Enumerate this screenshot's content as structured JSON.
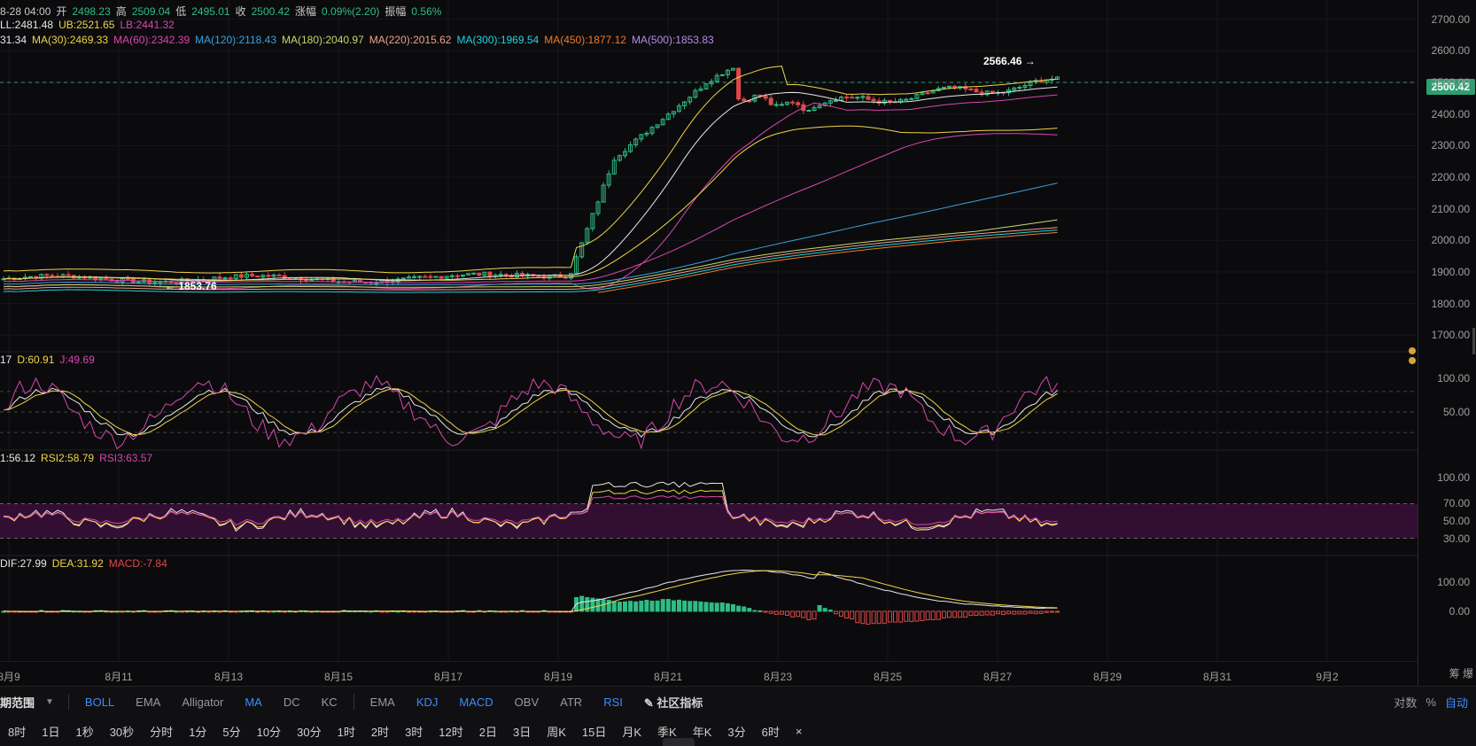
{
  "header": {
    "ohlc": [
      {
        "label": "8-28 04:00",
        "color": "#c8c8c8"
      },
      {
        "label": "开",
        "color": "#c8c8c8"
      },
      {
        "label": "2498.23",
        "color": "#2ebd85"
      },
      {
        "label": "高",
        "color": "#c8c8c8"
      },
      {
        "label": "2509.04",
        "color": "#2ebd85"
      },
      {
        "label": "低",
        "color": "#c8c8c8"
      },
      {
        "label": "2495.01",
        "color": "#2ebd85"
      },
      {
        "label": "收",
        "color": "#c8c8c8"
      },
      {
        "label": "2500.42",
        "color": "#2ebd85"
      },
      {
        "label": "涨幅",
        "color": "#c8c8c8"
      },
      {
        "label": "0.09%(2.20)",
        "color": "#2ebd85"
      },
      {
        "label": "振幅",
        "color": "#c8c8c8"
      },
      {
        "label": "0.56%",
        "color": "#2ebd85"
      }
    ],
    "boll": [
      {
        "label": "LL:2481.48",
        "color": "#e8e8e8"
      },
      {
        "label": "UB:2521.65",
        "color": "#f0d44a"
      },
      {
        "label": "LB:2441.32",
        "color": "#d946b0"
      }
    ],
    "ma": [
      {
        "label": "31.34",
        "color": "#e8e8e8"
      },
      {
        "label": "MA(30):2469.33",
        "color": "#f0d44a"
      },
      {
        "label": "MA(60):2342.39",
        "color": "#d946b0"
      },
      {
        "label": "MA(120):2118.43",
        "color": "#3aa0e0"
      },
      {
        "label": "MA(180):2040.97",
        "color": "#c7d86a"
      },
      {
        "label": "MA(220):2015.62",
        "color": "#f0a08a"
      },
      {
        "label": "MA(300):1969.54",
        "color": "#22d3e0"
      },
      {
        "label": "MA(450):1877.12",
        "color": "#f07a2a"
      },
      {
        "label": "MA(500):1853.83",
        "color": "#b48cf0"
      }
    ]
  },
  "kdj_legend": [
    {
      "label": "17",
      "color": "#e8e8e8"
    },
    {
      "label": "D:60.91",
      "color": "#f0d44a"
    },
    {
      "label": "J:49.69",
      "color": "#d946b0"
    }
  ],
  "rsi_legend": [
    {
      "label": "1:56.12",
      "color": "#e8e8e8"
    },
    {
      "label": "RSI2:58.79",
      "color": "#f0d44a"
    },
    {
      "label": "RSI3:63.57",
      "color": "#d946b0"
    }
  ],
  "macd_legend": [
    {
      "label": "DIF:27.99",
      "color": "#e8e8e8"
    },
    {
      "label": "DEA:31.92",
      "color": "#f0d44a"
    },
    {
      "label": "MACD:-7.84",
      "color": "#e04848"
    }
  ],
  "price_axis": [
    "2700.00",
    "2600.00",
    "2500.00",
    "2400.00",
    "2300.00",
    "2200.00",
    "2100.00",
    "2000.00",
    "1900.00",
    "1800.00",
    "1700.00"
  ],
  "current_price": "2500.42",
  "kdj_axis": [
    "100.00",
    "50.00"
  ],
  "rsi_axis": [
    "100.00",
    "70.00",
    "50.00",
    "30.00"
  ],
  "macd_axis": [
    "100.00",
    "0.00"
  ],
  "max_label": "2566.46 →",
  "min_label": "← 1853.76",
  "dates": [
    "8月9",
    "8月11",
    "8月13",
    "8月15",
    "8月17",
    "8月19",
    "8月21",
    "8月23",
    "8月25",
    "8月27",
    "8月29",
    "8月31",
    "9月2"
  ],
  "axis_corner": "筹 爆",
  "toolbar": {
    "title": "期范围",
    "main_indicators": [
      {
        "label": "BOLL",
        "active": true
      },
      {
        "label": "EMA",
        "active": false
      },
      {
        "label": "Alligator",
        "active": false
      },
      {
        "label": "MA",
        "active": true
      },
      {
        "label": "DC",
        "active": false
      },
      {
        "label": "KC",
        "active": false
      }
    ],
    "sub_indicators": [
      {
        "label": "EMA",
        "active": false
      },
      {
        "label": "KDJ",
        "active": true
      },
      {
        "label": "MACD",
        "active": true
      },
      {
        "label": "OBV",
        "active": false
      },
      {
        "label": "ATR",
        "active": false
      },
      {
        "label": "RSI",
        "active": true
      }
    ],
    "community": "社区指标",
    "right": [
      {
        "label": "对数",
        "active": false
      },
      {
        "label": "%",
        "active": false
      },
      {
        "label": "自动",
        "active": true
      }
    ]
  },
  "timeframes": [
    "8时",
    "1日",
    "1秒",
    "30秒",
    "分时",
    "1分",
    "5分",
    "10分",
    "30分",
    "1时",
    "2时",
    "3时",
    "12时",
    "2日",
    "3日",
    "周K",
    "15日",
    "月K",
    "季K",
    "年K",
    "3分",
    "6时",
    "×"
  ],
  "colors": {
    "up": "#2ebd85",
    "down": "#e04848",
    "bg": "#0b0b0d",
    "grid": "#1a1a1d"
  }
}
